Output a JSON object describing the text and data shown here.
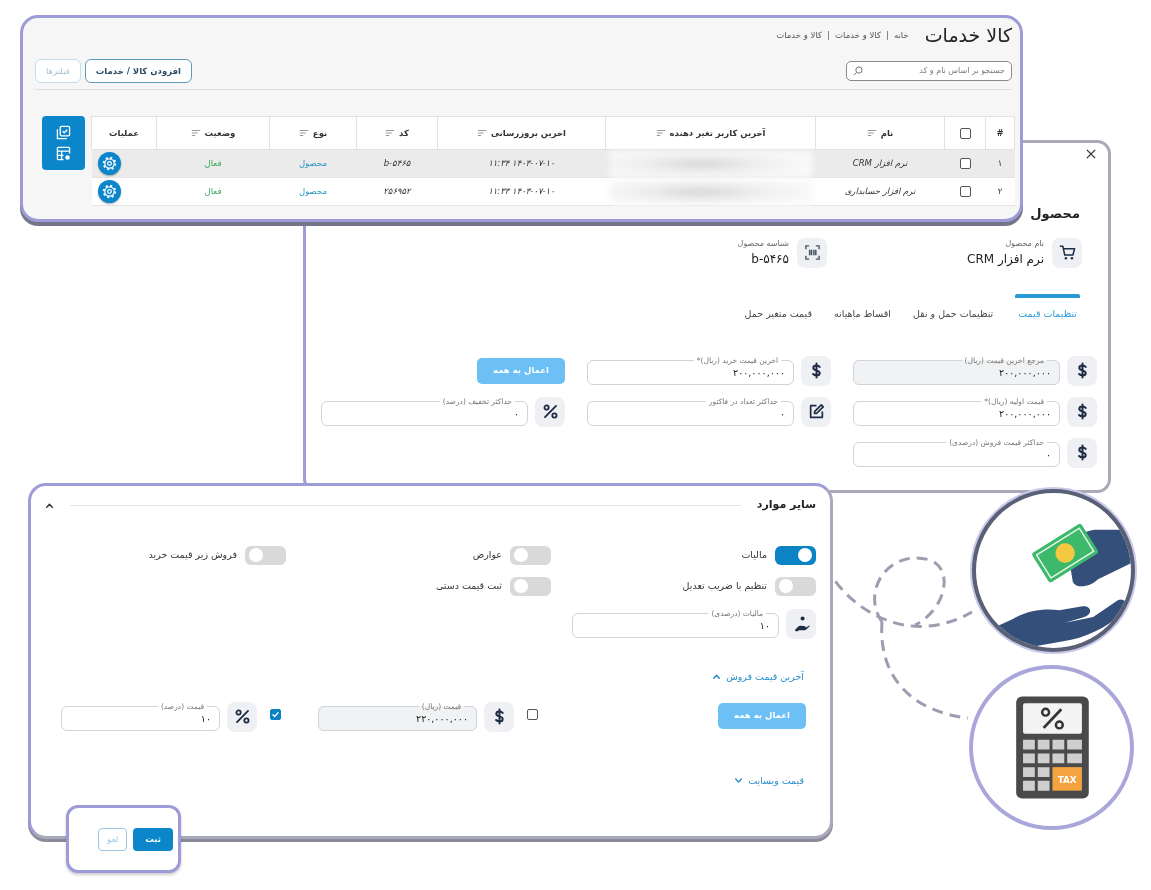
{
  "list_page": {
    "title": "کالا خدمات",
    "breadcrumb": [
      "خانه",
      "کالا و خدمات",
      "کالا و خدمات"
    ],
    "search": {
      "placeholder": "جستجو بر اساس نام و کد"
    },
    "buttons": [
      {
        "label": "افزودن کالا / خدمات",
        "disabled": false
      },
      {
        "label": "فیلترها",
        "disabled": true
      }
    ],
    "table": {
      "columns": [
        {
          "kind": "text",
          "label": "#",
          "sortable": false
        },
        {
          "kind": "checkbox",
          "checked": false
        },
        {
          "kind": "text",
          "label": "نام",
          "sortable": true
        },
        {
          "kind": "text",
          "label": "آخرین کاربر تغیر دهنده",
          "sortable": true
        },
        {
          "kind": "text",
          "label": "اخرین بروزرسانی",
          "sortable": true
        },
        {
          "kind": "text",
          "label": "کد",
          "sortable": true
        },
        {
          "kind": "text",
          "label": "نوع",
          "sortable": true
        },
        {
          "kind": "text",
          "label": "وضعیت",
          "sortable": true
        },
        {
          "kind": "text",
          "label": "عملیات",
          "sortable": false
        }
      ],
      "rows": [
        {
          "index": "۱",
          "checked": false,
          "name": "نرم افزار CRM",
          "updated": "۱۴۰۳-۰۷-۱۰ ۱۱:۳۴",
          "code": "b-۵۴۶۵",
          "type": "محصول",
          "status": "فعال",
          "selected": true
        },
        {
          "index": "۲",
          "checked": false,
          "name": "نرم افزار حسابداری",
          "updated": "۱۴۰۳-۰۷-۱۰ ۱۱:۳۳",
          "code": "۲۵۶۹۵۲",
          "type": "محصول",
          "status": "فعال",
          "selected": false
        }
      ]
    }
  },
  "product_dialog": {
    "title": "محصول",
    "info": [
      {
        "label": "نام محصول",
        "value": "نرم افزار CRM"
      },
      {
        "label": "شناسه محصول",
        "value": "b-۵۴۶۵"
      }
    ],
    "tabs": [
      {
        "label": "تنظیمات قیمت",
        "selected": true
      },
      {
        "label": "تنظیمات حمل و نقل",
        "selected": false
      },
      {
        "label": "اقساط ماهیانه",
        "selected": false
      },
      {
        "label": "قیمت متغیر حمل",
        "selected": false
      }
    ],
    "field_rows": [
      [
        {
          "kind": "price",
          "label": "مرجع اخرین قیمت (ریال)",
          "value": "۲۰۰,۰۰۰,۰۰۰",
          "disabled": true
        },
        {
          "kind": "price",
          "label": "اخرین قیمت خرید (ریال)*",
          "value": "۲۰۰,۰۰۰,۰۰۰",
          "disabled": false
        },
        {
          "kind": "button",
          "label": "اعمال به همه"
        }
      ],
      [
        {
          "kind": "price",
          "label": "قیمت اولیه (ریال)*",
          "value": "۲۰۰,۰۰۰,۰۰۰",
          "disabled": false
        },
        {
          "kind": "count",
          "label": "حداکثر تعداد در فاکتور",
          "value": "۰",
          "disabled": false
        },
        {
          "kind": "percent",
          "label": "حداکثر تخفیف (درصد)",
          "value": "۰",
          "disabled": false
        }
      ],
      [
        {
          "kind": "price",
          "label": "حداکثر قیمت فروش (درصدی)",
          "value": "۰",
          "disabled": false
        }
      ]
    ]
  },
  "other_section": {
    "title": "سایر موارد",
    "expanded": true,
    "toggles": [
      {
        "label": "مالیات",
        "on": true
      },
      {
        "label": "عوارض",
        "on": false
      },
      {
        "label": "فروش زیر قیمت خرید",
        "on": false
      },
      {
        "label": "تنظیم با ضریب تعدیل",
        "on": false
      },
      {
        "label": "ثبت قیمت دستی",
        "on": false
      }
    ],
    "tax_field": {
      "kind": "tax",
      "label": "مالیات (درصدی)",
      "value": "۱۰",
      "disabled": false
    },
    "last_sale": {
      "title": "آخرین قیمت فروش",
      "expanded": true,
      "apply_button": "اعمال به همه",
      "options": [
        {
          "checked": false,
          "field": {
            "kind": "price",
            "label": "قیمت (ریال)",
            "value": "۲۲۰,۰۰۰,۰۰۰",
            "disabled": true
          }
        },
        {
          "checked": true,
          "field": {
            "kind": "percent",
            "label": "قیمت (درصد)",
            "value": "۱۰",
            "disabled": false
          }
        }
      ]
    },
    "website_price": {
      "title": "قیمت وبسایت",
      "expanded": false
    }
  },
  "footer_buttons": [
    {
      "label": "ثبت",
      "kind": "primary"
    },
    {
      "label": "لغو",
      "kind": "outline"
    }
  ],
  "calculator": {
    "key_label": "TAX"
  }
}
